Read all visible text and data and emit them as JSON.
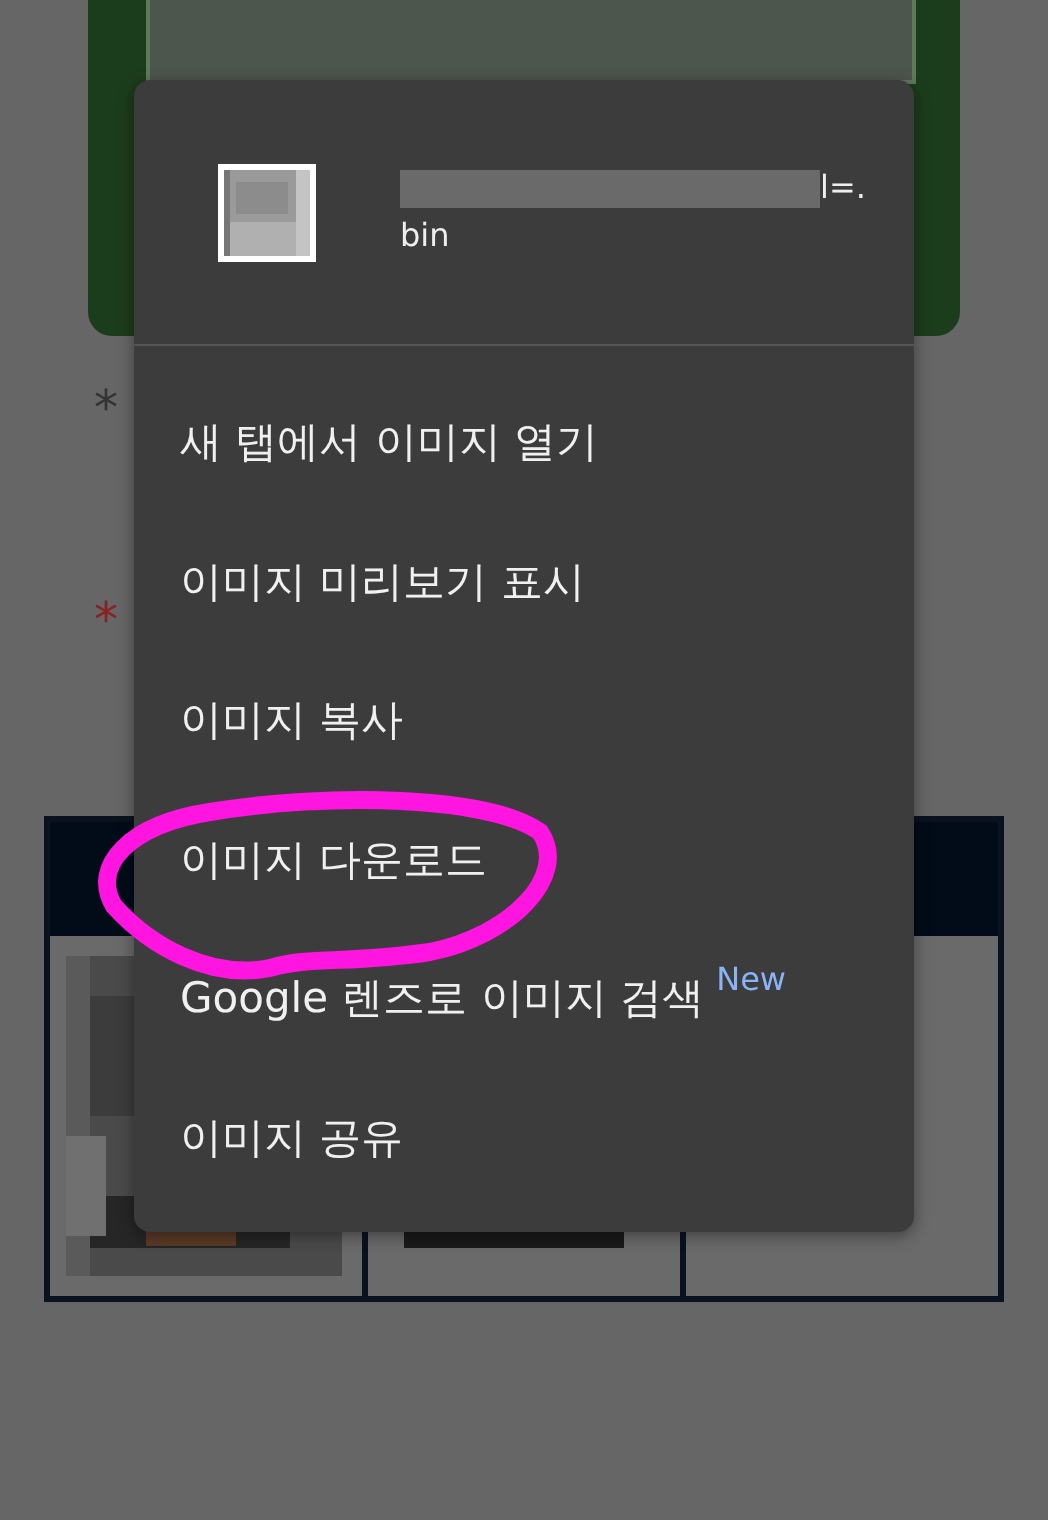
{
  "page": {
    "required_marks": [
      {
        "kind": "plain",
        "text": "*"
      },
      {
        "kind": "required",
        "text": "*"
      }
    ],
    "table": {
      "cells": [
        {
          "kind": "picture"
        },
        {
          "kind": "redacted"
        },
        {
          "kind": "empty"
        }
      ]
    }
  },
  "context_menu": {
    "header": {
      "file_name_end": "l=.",
      "file_name_wrap": "bin"
    },
    "items": [
      {
        "label": "새 탭에서 이미지 열기",
        "highlighted": false
      },
      {
        "label": "이미지 미리보기 표시",
        "highlighted": false
      },
      {
        "label": "이미지 복사",
        "highlighted": false
      },
      {
        "label": "이미지 다운로드",
        "highlighted": true
      },
      {
        "label": "Google 렌즈로 이미지 검색",
        "badge": "New",
        "highlighted": false
      },
      {
        "label": "이미지 공유",
        "highlighted": false
      }
    ]
  }
}
